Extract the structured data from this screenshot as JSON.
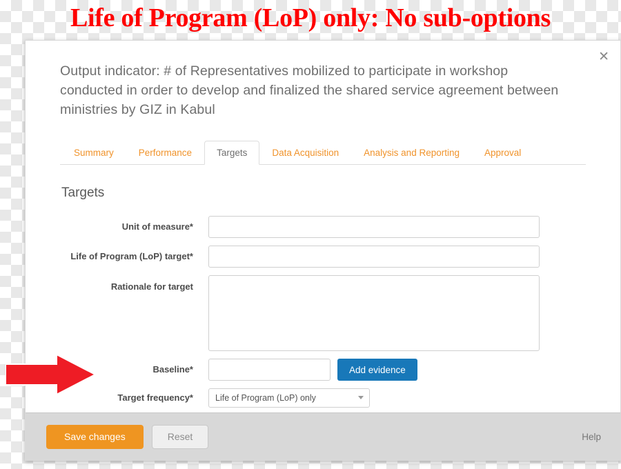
{
  "banner": {
    "title": "Life of Program (LoP) only: No sub-options"
  },
  "modal": {
    "close_icon": "close-icon",
    "heading": "Output indicator: # of Representatives mobilized to participate in workshop conducted in order to develop and finalized the shared service agreement between ministries by GIZ in Kabul",
    "tabs": [
      {
        "label": "Summary",
        "active": false
      },
      {
        "label": "Performance",
        "active": false
      },
      {
        "label": "Targets",
        "active": true
      },
      {
        "label": "Data Acquisition",
        "active": false
      },
      {
        "label": "Analysis and Reporting",
        "active": false
      },
      {
        "label": "Approval",
        "active": false
      }
    ],
    "section_title": "Targets",
    "fields": {
      "unit_of_measure": {
        "label": "Unit of measure*",
        "value": "",
        "placeholder": ""
      },
      "lop_target": {
        "label": "Life of Program (LoP) target*",
        "value": "",
        "placeholder": ""
      },
      "rationale": {
        "label": "Rationale for target",
        "value": "",
        "placeholder": ""
      },
      "baseline": {
        "label": "Baseline*",
        "value": "",
        "placeholder": ""
      },
      "add_evidence": {
        "label": "Add evidence"
      },
      "target_frequency": {
        "label": "Target frequency*",
        "value": "Life of Program (LoP) only",
        "caret_icon": "chevron-down-icon"
      }
    },
    "footer": {
      "save_label": "Save changes",
      "reset_label": "Reset",
      "help_label": "Help"
    }
  },
  "annotation": {
    "arrow_icon": "red-arrow-icon",
    "arrow_color": "#ee1c25"
  }
}
